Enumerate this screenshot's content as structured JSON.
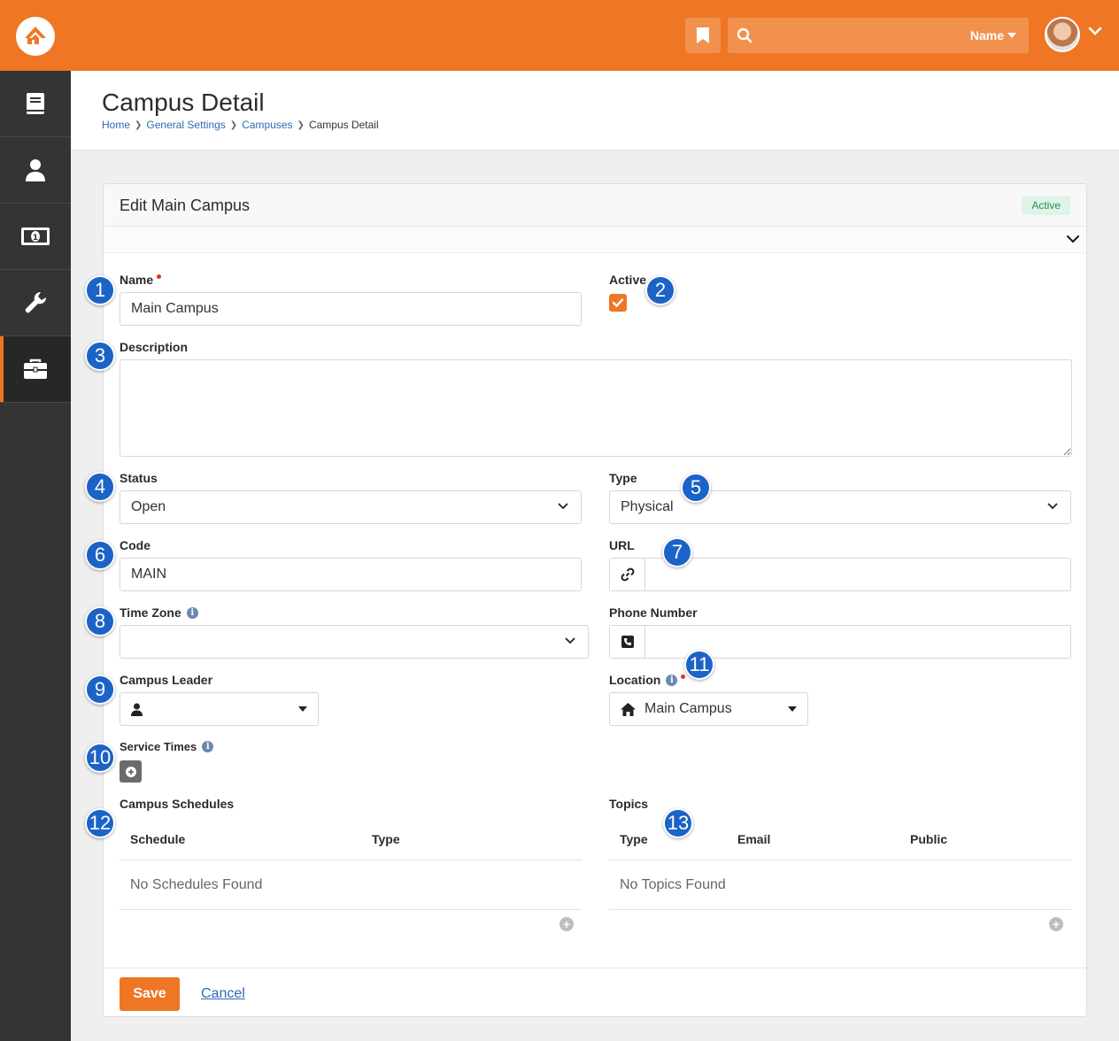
{
  "header": {
    "search_type": "Name",
    "search_placeholder": ""
  },
  "page": {
    "title": "Campus Detail",
    "breadcrumbs": [
      "Home",
      "General Settings",
      "Campuses",
      "Campus Detail"
    ]
  },
  "panel": {
    "title": "Edit Main Campus",
    "status_label": "Active"
  },
  "form": {
    "name": {
      "label": "Name",
      "value": "Main Campus"
    },
    "active": {
      "label": "Active",
      "checked": true
    },
    "description": {
      "label": "Description",
      "value": ""
    },
    "status": {
      "label": "Status",
      "value": "Open"
    },
    "type": {
      "label": "Type",
      "value": "Physical"
    },
    "code": {
      "label": "Code",
      "value": "MAIN"
    },
    "url": {
      "label": "URL",
      "value": ""
    },
    "time_zone": {
      "label": "Time Zone",
      "value": ""
    },
    "phone_number": {
      "label": "Phone Number",
      "value": ""
    },
    "campus_leader": {
      "label": "Campus Leader",
      "value": ""
    },
    "location": {
      "label": "Location",
      "value": "Main Campus"
    },
    "service_times": {
      "label": "Service Times"
    },
    "campus_schedules": {
      "label": "Campus Schedules",
      "columns": [
        "Schedule",
        "Type"
      ],
      "empty": "No Schedules Found"
    },
    "topics": {
      "label": "Topics",
      "columns": [
        "Type",
        "Email",
        "Public"
      ],
      "empty": "No Topics Found"
    }
  },
  "actions": {
    "save": "Save",
    "cancel": "Cancel"
  },
  "callouts": [
    "1",
    "2",
    "3",
    "4",
    "5",
    "6",
    "7",
    "8",
    "9",
    "10",
    "11",
    "12",
    "13"
  ],
  "colors": {
    "brand": "#ee7625",
    "sidebar": "#343434",
    "link": "#2f6bb5",
    "callout": "#1c63c8",
    "active_badge_bg": "#dff4e8"
  }
}
